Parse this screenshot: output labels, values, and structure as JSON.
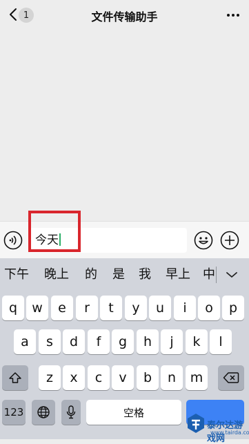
{
  "header": {
    "title": "文件传输助手",
    "unread_count": "1"
  },
  "input": {
    "value": "今天"
  },
  "candidates": [
    "下午",
    "晚上",
    "的",
    "是",
    "我",
    "早上",
    "中"
  ],
  "keyboard": {
    "row1": [
      "q",
      "w",
      "e",
      "r",
      "t",
      "y",
      "u",
      "i",
      "o",
      "p"
    ],
    "row2": [
      "a",
      "s",
      "d",
      "f",
      "g",
      "h",
      "j",
      "k",
      "l"
    ],
    "row3": [
      "z",
      "x",
      "c",
      "v",
      "b",
      "n",
      "m"
    ],
    "numbers_label": "123",
    "space_label": "空格"
  },
  "watermark": {
    "name": "泰尔达游戏网",
    "url": "www.tairda.com"
  },
  "colors": {
    "highlight": "#d9262d",
    "caret": "#2aae67",
    "keyboard_bg": "#d2d5dc"
  }
}
